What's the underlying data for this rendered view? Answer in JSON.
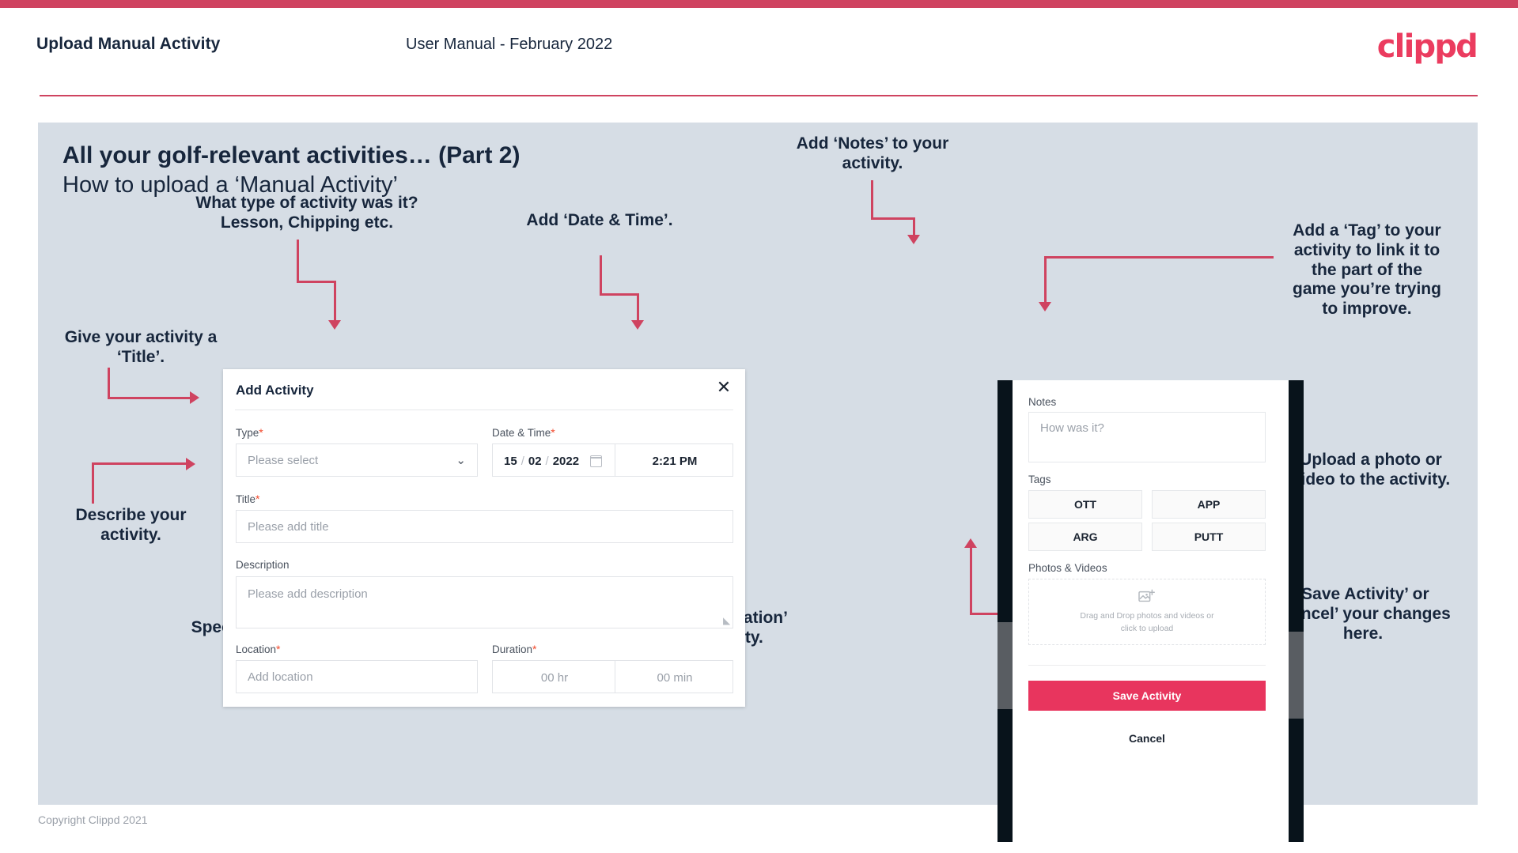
{
  "header": {
    "title": "Upload Manual Activity",
    "subtitle": "User Manual - February 2022",
    "logo": "clippd"
  },
  "slide": {
    "title": "All your golf-relevant activities… (Part 2)",
    "subtitle": "How to upload a ‘Manual Activity’"
  },
  "callouts": {
    "type": "What type of activity was it?\nLesson, Chipping etc.",
    "datetime": "Add ‘Date & Time’.",
    "title": "Give your activity a\n‘Title’.",
    "description": "Describe your\nactivity.",
    "location": "Specify the ‘Location’.",
    "duration": "Specify the ‘Duration’\nof your activity.",
    "notes": "Add ‘Notes’ to your\nactivity.",
    "tags": "Add a ‘Tag’ to your\nactivity to link it to\nthe part of the\ngame you’re trying\nto improve.",
    "photos": "Upload a photo or\nvideo to the activity.",
    "save": "‘Save Activity’ or\n‘Cancel’ your changes\nhere."
  },
  "dialog": {
    "title": "Add Activity",
    "close_icon": "close-icon",
    "type": {
      "label": "Type",
      "required": "*",
      "placeholder": "Please select",
      "value": ""
    },
    "datetime": {
      "label": "Date & Time",
      "required": "*",
      "day": "15",
      "month": "02",
      "year": "2022",
      "separator": "/",
      "time": "2:21 PM",
      "calendar_icon": "calendar-icon"
    },
    "title_field": {
      "label": "Title",
      "required": "*",
      "placeholder": "Please add title",
      "value": ""
    },
    "description": {
      "label": "Description",
      "required": "",
      "placeholder": "Please add description",
      "value": ""
    },
    "location": {
      "label": "Location",
      "required": "*",
      "placeholder": "Add location",
      "value": ""
    },
    "duration": {
      "label": "Duration",
      "required": "*",
      "hours_placeholder": "00 hr",
      "minutes_placeholder": "00 min"
    }
  },
  "phone": {
    "notes": {
      "label": "Notes",
      "placeholder": "How was it?",
      "value": ""
    },
    "tags": {
      "label": "Tags",
      "items": [
        {
          "label": "OTT"
        },
        {
          "label": "APP"
        },
        {
          "label": "ARG"
        },
        {
          "label": "PUTT"
        }
      ]
    },
    "photos": {
      "label": "Photos & Videos",
      "icon": "add-image-icon",
      "hint": "Drag and Drop photos and videos or\nclick to upload"
    },
    "save_label": "Save Activity",
    "cancel_label": "Cancel"
  },
  "footer": {
    "copyright": "Copyright Clippd 2021"
  },
  "colors": {
    "accent": "#cf4360",
    "brand": "#eb3c5f",
    "save_button": "#e8355e",
    "slide_bg": "#d6dde5",
    "text": "#17263c",
    "required": "#f2492c"
  }
}
